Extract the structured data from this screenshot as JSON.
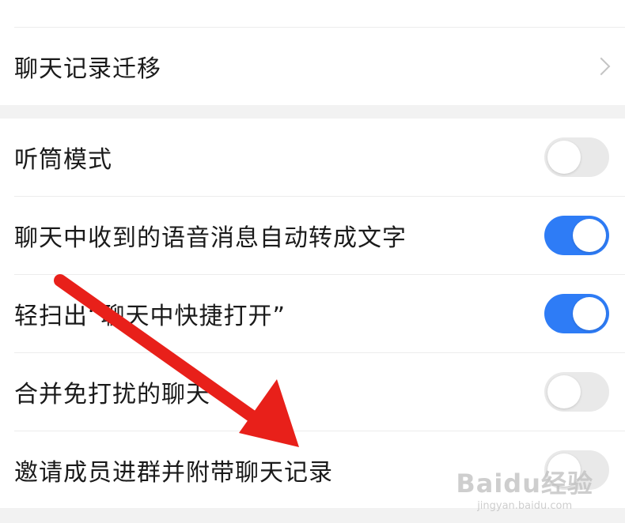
{
  "settings": {
    "chat_history_migration": {
      "label": "聊天记录迁移"
    },
    "items": [
      {
        "label": "听筒模式",
        "enabled": false
      },
      {
        "label": "聊天中收到的语音消息自动转成文字",
        "enabled": true
      },
      {
        "label": "轻扫出“聊天中快捷打开”",
        "enabled": true
      },
      {
        "label": "合并免打扰的聊天",
        "enabled": false
      },
      {
        "label": "邀请成员进群并附带聊天记录",
        "enabled": false
      }
    ]
  },
  "annotation": {
    "arrow_color": "#e8201a"
  },
  "theme": {
    "accent": "#2e7cf6",
    "toggle_off": "#e9e9e9"
  },
  "watermark": {
    "logo": "Baidu经验",
    "url": "jingyan.baidu.com"
  }
}
